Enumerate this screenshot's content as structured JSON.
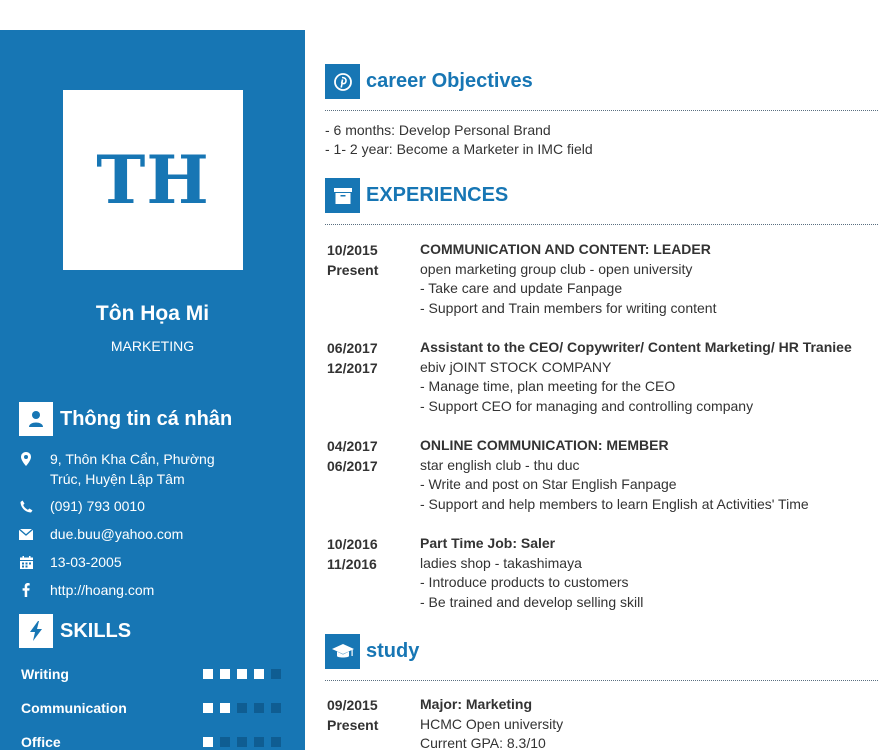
{
  "sidebar": {
    "initials": "TH",
    "name": "Tôn Họa Mi",
    "role": "MARKETING",
    "personal_heading": "Thông tin cá nhân",
    "address_line1": "9, Thôn Kha Cẩn, Phường",
    "address_line2": "Trúc, Huyện Lập Tâm",
    "phone": "(091) 793 0010",
    "email": "due.buu@yahoo.com",
    "birthday": "13-03-2005",
    "website": "http://hoang.com",
    "skills_heading": "SKILLS",
    "skills": [
      {
        "name": "Writing",
        "level": 4,
        "max": 5
      },
      {
        "name": "Communication",
        "level": 2,
        "max": 5
      },
      {
        "name": "Office",
        "level": 1,
        "max": 5
      }
    ]
  },
  "objectives": {
    "heading": "career Objectives",
    "lines": [
      "- 6 months: Develop Personal Brand",
      "- 1- 2 year: Become a Marketer in IMC field"
    ]
  },
  "experiences": {
    "heading": "EXPERIENCES",
    "items": [
      {
        "date1": "10/2015",
        "date2": "Present",
        "title": "COMMUNICATION AND CONTENT: LEADER",
        "org": "open marketing group club - open university",
        "d1": "- Take care and update Fanpage",
        "d2": "- Support and Train members for writing content"
      },
      {
        "date1": "06/2017",
        "date2": "12/2017",
        "title": "Assistant to the CEO/ Copywriter/ Content Marketing/ HR Traniee",
        "org": "ebiv jOINT STOCK COMPANY",
        "d1": "- Manage time, plan meeting for the CEO",
        "d2": "- Support CEO for managing and controlling company"
      },
      {
        "date1": "04/2017",
        "date2": "06/2017",
        "title": "ONLINE COMMUNICATION: MEMBER",
        "org": "star english club - thu duc",
        "d1": "- Write and post on Star English Fanpage",
        "d2": "- Support and help members to learn English at Activities' Time"
      },
      {
        "date1": "10/2016",
        "date2": "11/2016",
        "title": "Part Time Job: Saler",
        "org": "ladies shop - takashimaya",
        "d1": "- Introduce products to customers",
        "d2": "- Be trained and develop selling skill"
      }
    ]
  },
  "study": {
    "heading": "study",
    "date1": "09/2015",
    "date2": "Present",
    "title": "Major: Marketing",
    "org": "HCMC Open university",
    "gpa": "Current GPA: 8.3/10"
  },
  "colors": {
    "accent": "#1776b4",
    "dot_off": "#0f5d92"
  }
}
